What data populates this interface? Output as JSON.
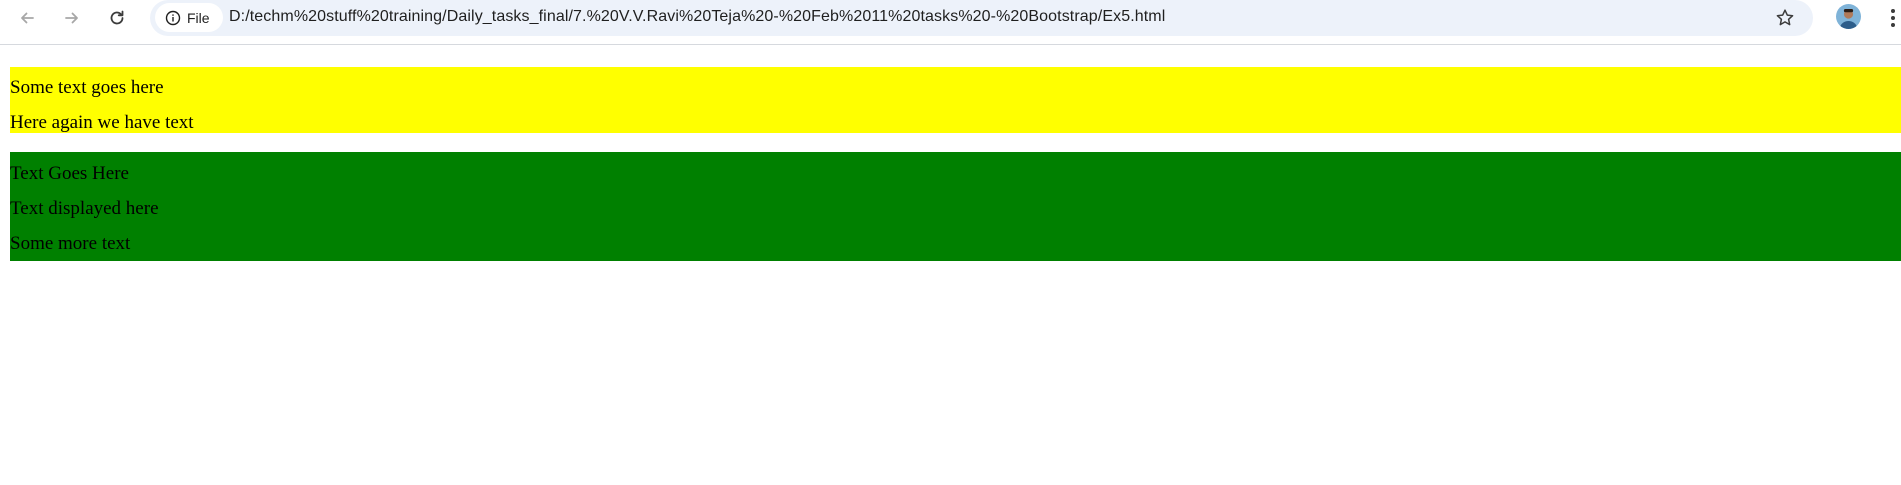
{
  "browser": {
    "chip_label": "File",
    "url": "D:/techm%20stuff%20training/Daily_tasks_final/7.%20V.V.Ravi%20Teja%20-%20Feb%2011%20tasks%20-%20Bootstrap/Ex5.html",
    "icons": [
      "back-arrow-icon",
      "forward-arrow-icon",
      "reload-icon",
      "info-icon",
      "star-icon",
      "avatar",
      "kebab-menu-icon"
    ]
  },
  "page": {
    "yellow_box": {
      "color": "#ffff00",
      "lines": [
        "Some text goes here",
        "Here again we have text"
      ]
    },
    "green_box": {
      "color": "#008000",
      "lines": [
        "Text Goes Here",
        "Text displayed here",
        "Some more text"
      ]
    }
  }
}
